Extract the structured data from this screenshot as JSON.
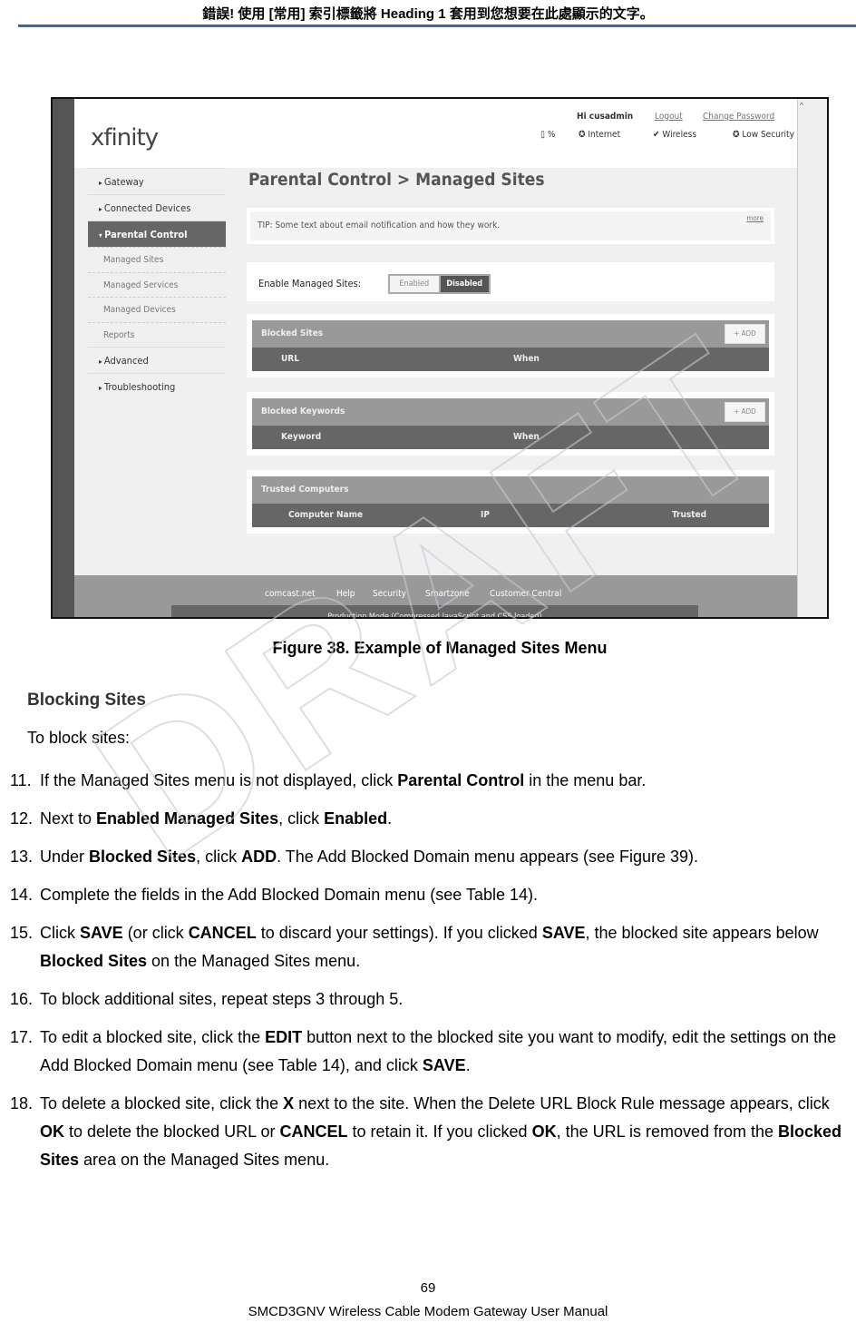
{
  "header": "錯誤! 使用 [常用] 索引標籤將 Heading 1 套用到您想要在此處顯示的文字。",
  "watermark": "DRAFT",
  "screenshot": {
    "logo": "xfinity",
    "greeting": "Hi cusadmin",
    "logout": "Logout",
    "change_password": "Change Password",
    "battery": "%",
    "status": [
      "Internet",
      "Wireless",
      "Low Security"
    ],
    "sidebar": [
      {
        "label": "Gateway",
        "type": "top"
      },
      {
        "label": "Connected Devices",
        "type": "top"
      },
      {
        "label": "Parental Control",
        "type": "active"
      },
      {
        "label": "Managed Sites",
        "type": "sub"
      },
      {
        "label": "Managed Services",
        "type": "sub"
      },
      {
        "label": "Managed Devices",
        "type": "sub"
      },
      {
        "label": "Reports",
        "type": "sub"
      },
      {
        "label": "Advanced",
        "type": "top"
      },
      {
        "label": "Troubleshooting",
        "type": "top"
      }
    ],
    "title": "Parental Control > Managed Sites",
    "tip": "TIP: Some text about email notification and how they work.",
    "tip_more": "more",
    "enable_label": "Enable Managed Sites:",
    "enabled": "Enabled",
    "disabled": "Disabled",
    "blocked_sites": {
      "title": "Blocked Sites",
      "add": "+ ADD",
      "cols": [
        "URL",
        "When"
      ]
    },
    "blocked_keywords": {
      "title": "Blocked Keywords",
      "add": "+ ADD",
      "cols": [
        "Keyword",
        "When"
      ]
    },
    "trusted": {
      "title": "Trusted Computers",
      "cols": [
        "Computer Name",
        "IP",
        "Trusted"
      ]
    },
    "footer_links": [
      "comcast.net",
      "Help",
      "Security",
      "Smartzone",
      "Customer Central"
    ],
    "footer_note": "Production Mode (Compressed JavaScript and CSS loaded)"
  },
  "caption": "Figure 38. Example of Managed Sites Menu",
  "section_title": "Blocking Sites",
  "intro": "To block sites:",
  "steps": [
    {
      "n": "11.",
      "s": [
        {
          "t": "If the Managed Sites menu is not displayed, click "
        },
        {
          "t": "Parental Control",
          "b": true
        },
        {
          "t": " in the menu bar."
        }
      ]
    },
    {
      "n": "12.",
      "s": [
        {
          "t": "Next to "
        },
        {
          "t": "Enabled Managed Sites",
          "b": true
        },
        {
          "t": ", click "
        },
        {
          "t": "Enabled",
          "b": true
        },
        {
          "t": "."
        }
      ]
    },
    {
      "n": "13.",
      "s": [
        {
          "t": "Under "
        },
        {
          "t": "Blocked Sites",
          "b": true
        },
        {
          "t": ", click "
        },
        {
          "t": "ADD",
          "b": true
        },
        {
          "t": ". The Add Blocked Domain menu appears (see Figure 39)."
        }
      ]
    },
    {
      "n": "14.",
      "s": [
        {
          "t": "Complete the fields in the Add Blocked Domain menu (see Table 14)."
        }
      ]
    },
    {
      "n": "15.",
      "s": [
        {
          "t": "Click "
        },
        {
          "t": "SAVE",
          "b": true
        },
        {
          "t": " (or click "
        },
        {
          "t": "CANCEL",
          "b": true
        },
        {
          "t": " to discard your settings). If you clicked "
        },
        {
          "t": "SAVE",
          "b": true
        },
        {
          "t": ", the blocked site appears below "
        },
        {
          "t": "Blocked Sites",
          "b": true
        },
        {
          "t": " on the Managed Sites menu."
        }
      ]
    },
    {
      "n": "16.",
      "s": [
        {
          "t": "To block additional sites, repeat steps 3 through 5."
        }
      ]
    },
    {
      "n": "17.",
      "s": [
        {
          "t": "To edit a blocked site, click the "
        },
        {
          "t": "EDIT",
          "b": true
        },
        {
          "t": " button next to the blocked site you want to modify, edit the settings on the Add Blocked Domain menu (see Table 14), and click "
        },
        {
          "t": "SAVE",
          "b": true
        },
        {
          "t": "."
        }
      ]
    },
    {
      "n": "18.",
      "s": [
        {
          "t": "To delete a blocked site, click the "
        },
        {
          "t": "X",
          "b": true
        },
        {
          "t": " next to the site. When the Delete URL Block Rule message appears, click "
        },
        {
          "t": "OK",
          "b": true
        },
        {
          "t": " to delete the blocked URL or "
        },
        {
          "t": "CANCEL",
          "b": true
        },
        {
          "t": " to retain it. If you clicked "
        },
        {
          "t": "OK",
          "b": true
        },
        {
          "t": ", the URL is removed from the "
        },
        {
          "t": "Blocked Sites",
          "b": true
        },
        {
          "t": " area on the Managed Sites menu."
        }
      ]
    }
  ],
  "page_number": "69",
  "manual_title": "SMCD3GNV Wireless Cable Modem Gateway User Manual"
}
